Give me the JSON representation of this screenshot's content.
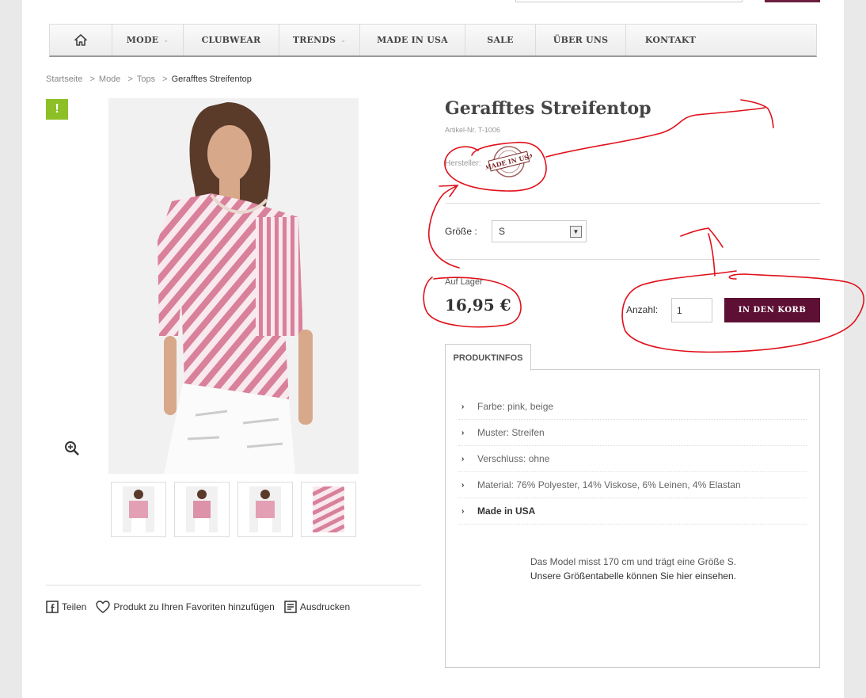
{
  "nav": {
    "items": [
      {
        "label": "",
        "icon": "home-icon"
      },
      {
        "label": "MODE",
        "caret": true
      },
      {
        "label": "CLUBWEAR",
        "caret": false
      },
      {
        "label": "TRENDS",
        "caret": true
      },
      {
        "label": "MADE IN USA",
        "caret": false
      },
      {
        "label": "SALE",
        "caret": false
      },
      {
        "label": "ÜBER UNS",
        "caret": false
      },
      {
        "label": "KONTAKT",
        "caret": false
      }
    ]
  },
  "breadcrumb": {
    "items": [
      "Startseite",
      "Mode",
      "Tops"
    ],
    "current": "Gerafftes Streifentop",
    "separator": ">"
  },
  "badge": {
    "label": "!"
  },
  "product": {
    "title": "Gerafftes Streifentop",
    "article_no": "Artikel-Nr. T-1006",
    "manufacturer_label": "Hersteller:",
    "seal_text": "MADE IN USA",
    "size_label": "Größe :",
    "size_value": "S",
    "stock": "Auf Lager",
    "price": "16,95 €",
    "qty_label": "Anzahl:",
    "qty_value": "1",
    "cart_button": "IN DEN KORB"
  },
  "tabs": {
    "info_label": "PRODUKTINFOS"
  },
  "info": [
    {
      "text": "Farbe: pink, beige",
      "strong": false
    },
    {
      "text": "Muster: Streifen",
      "strong": false
    },
    {
      "text": "Verschluss: ohne",
      "strong": false
    },
    {
      "text": "Material: 76% Polyester, 14% Viskose, 6% Leinen, 4% Elastan",
      "strong": false
    },
    {
      "text": "Made in USA",
      "strong": true
    }
  ],
  "model_note": {
    "line1": "Das Model misst 170 cm und trägt eine Größe S.",
    "line2": "Unsere Größentabelle können Sie hier einsehen."
  },
  "share": {
    "facebook": "Teilen",
    "favorites": "Produkt zu Ihren Favoriten hinzufügen",
    "print": "Ausdrucken"
  },
  "colors": {
    "accent": "#5e0f34",
    "badge": "#8cc026",
    "stripe": "#d9809a",
    "annotation": "#e0101a"
  }
}
